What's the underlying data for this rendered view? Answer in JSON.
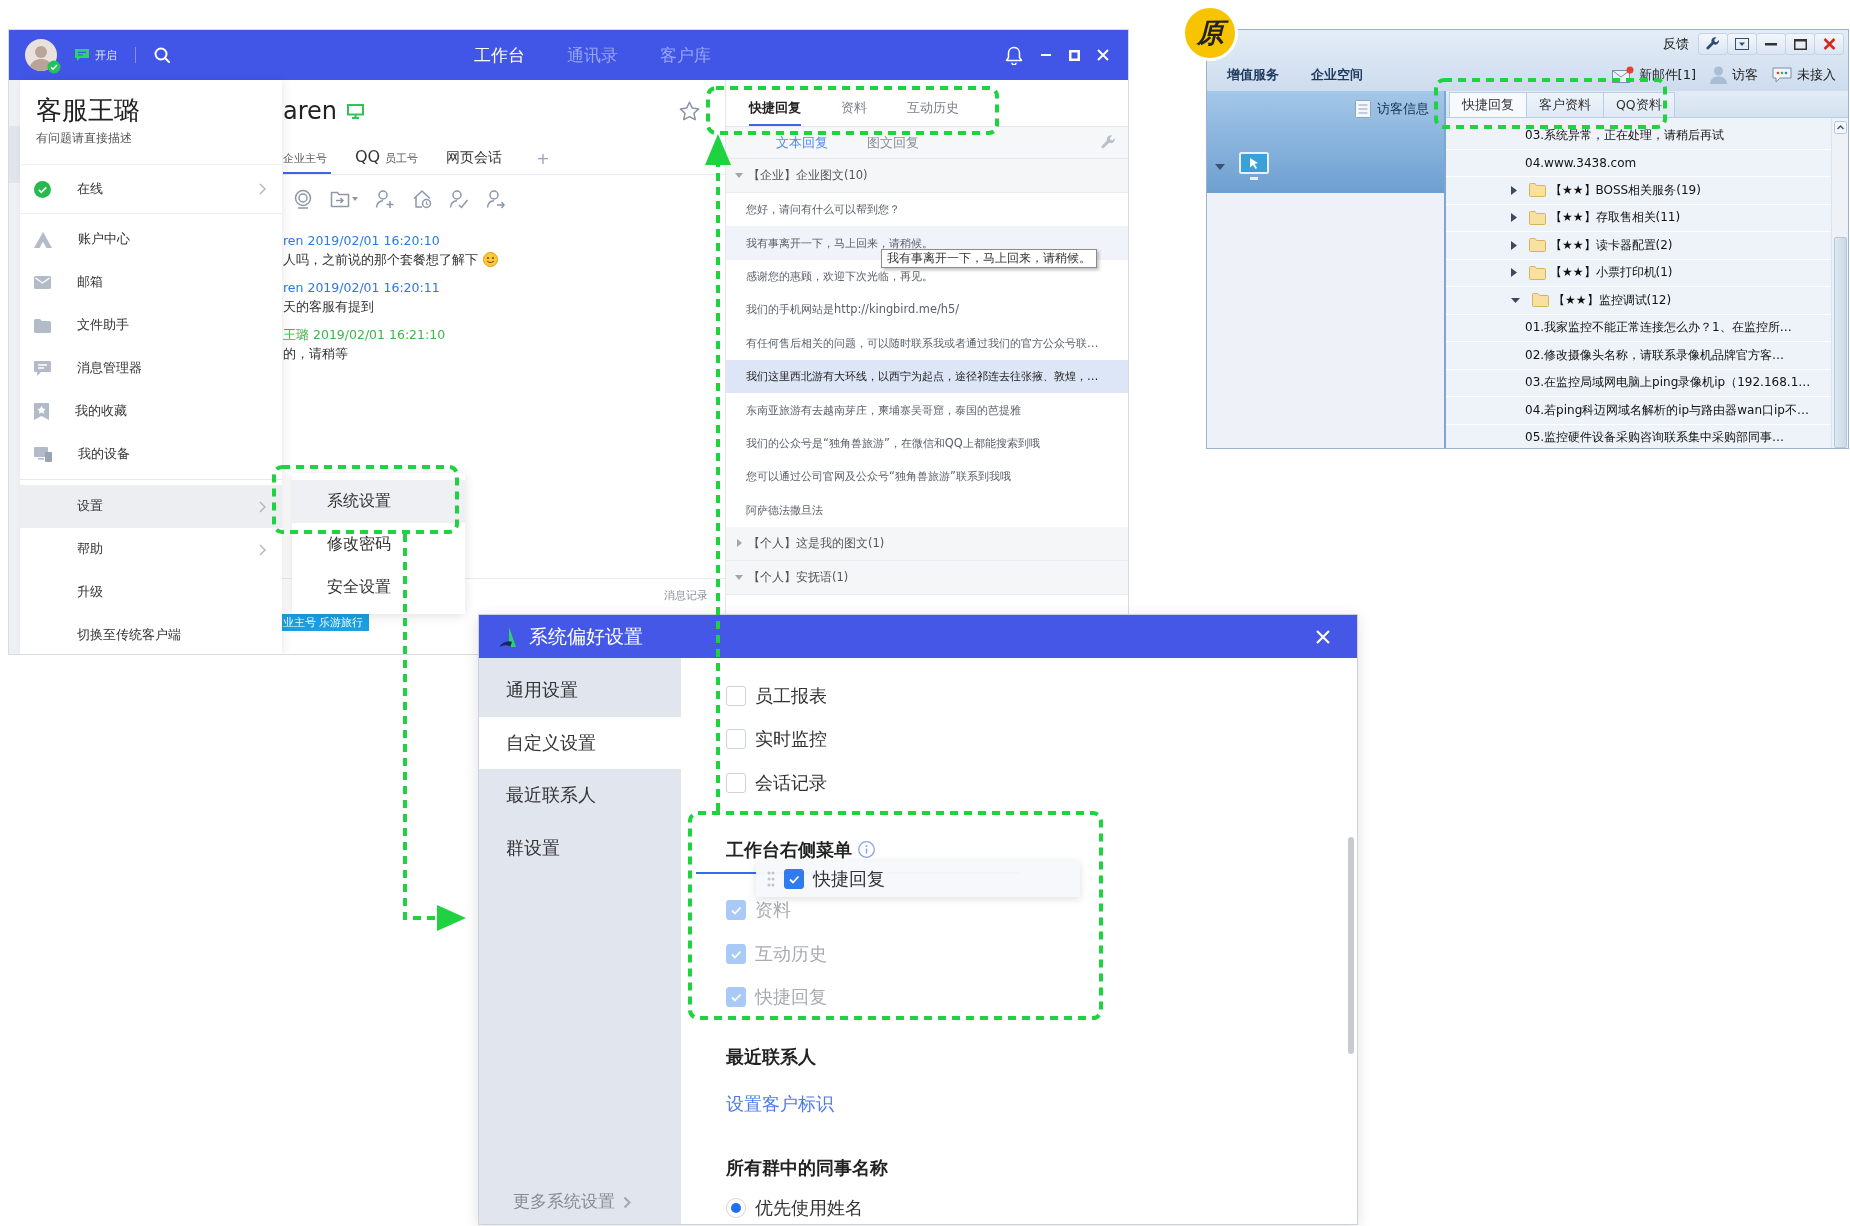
{
  "main_window": {
    "top_bar": {
      "status_label": "开启",
      "tabs": [
        {
          "label": "工作台",
          "selected": true
        },
        {
          "label": "通讯录",
          "selected": false
        },
        {
          "label": "客户库",
          "selected": false
        }
      ]
    },
    "account_menu": {
      "name": "客服王璐",
      "signature": "有问题请直接描述",
      "sections": [
        [
          {
            "label": "在线",
            "submenu": true,
            "selected": false
          }
        ],
        [
          {
            "label": "账户中心",
            "submenu": false,
            "selected": false
          },
          {
            "label": "邮箱",
            "submenu": false,
            "selected": false
          },
          {
            "label": "文件助手",
            "submenu": false,
            "selected": false
          },
          {
            "label": "消息管理器",
            "submenu": false,
            "selected": false
          },
          {
            "label": "我的收藏",
            "submenu": false,
            "selected": false
          },
          {
            "label": "我的设备",
            "submenu": false,
            "selected": false
          }
        ],
        [
          {
            "label": "设置",
            "submenu": true,
            "selected": true
          },
          {
            "label": "帮助",
            "submenu": true,
            "selected": false
          },
          {
            "label": "升级",
            "submenu": false,
            "selected": false
          },
          {
            "label": "切换至传统客户端",
            "submenu": false,
            "selected": false
          }
        ]
      ]
    },
    "settings_submenu": [
      {
        "label": "系统设置",
        "selected": true
      },
      {
        "label": "修改密码",
        "selected": false
      },
      {
        "label": "安全设置",
        "selected": false
      }
    ],
    "chat": {
      "contact": "aren",
      "tabs": [
        {
          "sublabel": "企业主号",
          "selected": true
        },
        {
          "label": "QQ",
          "sublabel": "员工号",
          "selected": false
        },
        {
          "label": "网页会话",
          "selected": false
        }
      ],
      "add_tab": "+",
      "messages": [
        {
          "kind": "customer",
          "sender": "ren 2019/02/01 16:20:10",
          "text": "人吗，之前说的那个套餐想了解下",
          "emoji": true
        },
        {
          "kind": "customer",
          "sender": "ren 2019/02/01 16:20:11",
          "text": "天的客服有提到",
          "emoji": false
        },
        {
          "kind": "agent",
          "sender": "王璐 2019/02/01 16:21:10",
          "text": "的，请稍等",
          "emoji": false
        }
      ],
      "history_link": "消息记录",
      "tag": "业主号 乐游旅行"
    },
    "quick_panel": {
      "tabs": [
        {
          "label": "快捷回复",
          "selected": true
        },
        {
          "label": "资料",
          "selected": false
        },
        {
          "label": "互动历史",
          "selected": false
        }
      ],
      "subtabs": [
        {
          "label": "文本回复",
          "selected": true
        },
        {
          "label": "图文回复",
          "selected": false
        }
      ],
      "groups": [
        {
          "title": "【企业】企业图文(10)",
          "expanded": true,
          "items": [
            {
              "text": "您好，请问有什么可以帮到您？",
              "selected": false,
              "hovered": false
            },
            {
              "text": "我有事离开一下，马上回来，请稍候。",
              "selected": false,
              "hovered": true,
              "tooltip": "我有事离开一下，马上回来，请稍候。"
            },
            {
              "text": "感谢您的惠顾，欢迎下次光临，再见。",
              "selected": false,
              "hovered": false
            },
            {
              "text": "我们的手机网站是http://kingbird.me/h5/",
              "selected": false,
              "hovered": false
            },
            {
              "text": "有任何售后相关的问题，可以随时联系我或者通过我们的官方公众号联…",
              "selected": false,
              "hovered": false
            },
            {
              "text": "我们这里西北游有大环线，以西宁为起点，途径祁连去往张掖、敦煌，…",
              "selected": true,
              "hovered": false
            },
            {
              "text": "东南亚旅游有去越南芽庄，柬埔寨吴哥窟，泰国的芭提雅",
              "selected": false,
              "hovered": false
            },
            {
              "text": "我们的公众号是“独角兽旅游”，在微信和QQ上都能搜索到哦",
              "selected": false,
              "hovered": false
            },
            {
              "text": "您可以通过公司官网及公众号“独角兽旅游”联系到我哦",
              "selected": false,
              "hovered": false
            },
            {
              "text": "阿萨德法撒旦法",
              "selected": false,
              "hovered": false
            }
          ]
        },
        {
          "title": "【个人】这是我的图文(1)",
          "expanded": false
        },
        {
          "title": "【个人】安抚语(1)",
          "expanded": true
        }
      ]
    }
  },
  "legacy_window": {
    "badge": "原",
    "feedback": "反馈",
    "menu": [
      "增值服务",
      "企业空间"
    ],
    "indicators": [
      "新邮件[1]",
      "访客",
      "未接入"
    ],
    "visitor_info": "访客信息",
    "tabs": [
      {
        "label": "快捷回复",
        "selected": true
      },
      {
        "label": "客户资料",
        "selected": false
      },
      {
        "label": "QQ资料",
        "selected": false
      }
    ],
    "tree": [
      {
        "kind": "reply",
        "text": "03.系统异常，正在处理，请稍后再试"
      },
      {
        "kind": "reply",
        "text": "04.www.3438.com"
      },
      {
        "kind": "folder",
        "text": "【★★】BOSS相关服务(19)",
        "expanded": false
      },
      {
        "kind": "folder",
        "text": "【★★】存取售相关(11)",
        "expanded": false
      },
      {
        "kind": "folder",
        "text": "【★★】读卡器配置(2)",
        "expanded": false
      },
      {
        "kind": "folder",
        "text": "【★★】小票打印机(1)",
        "expanded": false
      },
      {
        "kind": "folder",
        "text": "【★★】监控调试(12)",
        "expanded": true,
        "children": [
          {
            "kind": "reply",
            "text": "01.我家监控不能正常连接怎么办？1、在监控所…"
          },
          {
            "kind": "reply",
            "text": "02.修改摄像头名称，请联系录像机品牌官方客…"
          },
          {
            "kind": "reply",
            "text": "03.在监控局域网电脑上ping录像机ip（192.168.1…"
          },
          {
            "kind": "reply",
            "text": "04.若ping科迈网域名解析的ip与路由器wan口ip不…"
          },
          {
            "kind": "reply",
            "text": "05.监控硬件设备采购咨询联系集中采购部同事…"
          }
        ]
      }
    ]
  },
  "preferences_dialog": {
    "title": "系统偏好设置",
    "nav": [
      {
        "label": "通用设置",
        "selected": false
      },
      {
        "label": "自定义设置",
        "selected": true
      },
      {
        "label": "最近联系人",
        "selected": false
      },
      {
        "label": "群设置",
        "selected": false
      }
    ],
    "more_settings": "更多系统设置",
    "options": [
      {
        "label": "员工报表",
        "checked": false
      },
      {
        "label": "实时监控",
        "checked": false
      },
      {
        "label": "会话记录",
        "checked": false
      }
    ],
    "right_menu": {
      "title": "工作台右侧菜单",
      "dragging": {
        "label": "快捷回复",
        "checked": true
      },
      "items": [
        {
          "label": "资料",
          "checked": true,
          "disabled": true
        },
        {
          "label": "互动历史",
          "checked": true,
          "disabled": true
        },
        {
          "label": "快捷回复",
          "checked": true,
          "disabled": true
        }
      ]
    },
    "recent_contacts": {
      "title": "最近联系人",
      "link": "设置客户标识"
    },
    "colleague_names": {
      "title": "所有群中的同事名称",
      "options": [
        {
          "label": "优先使用姓名",
          "selected": true
        }
      ]
    }
  }
}
